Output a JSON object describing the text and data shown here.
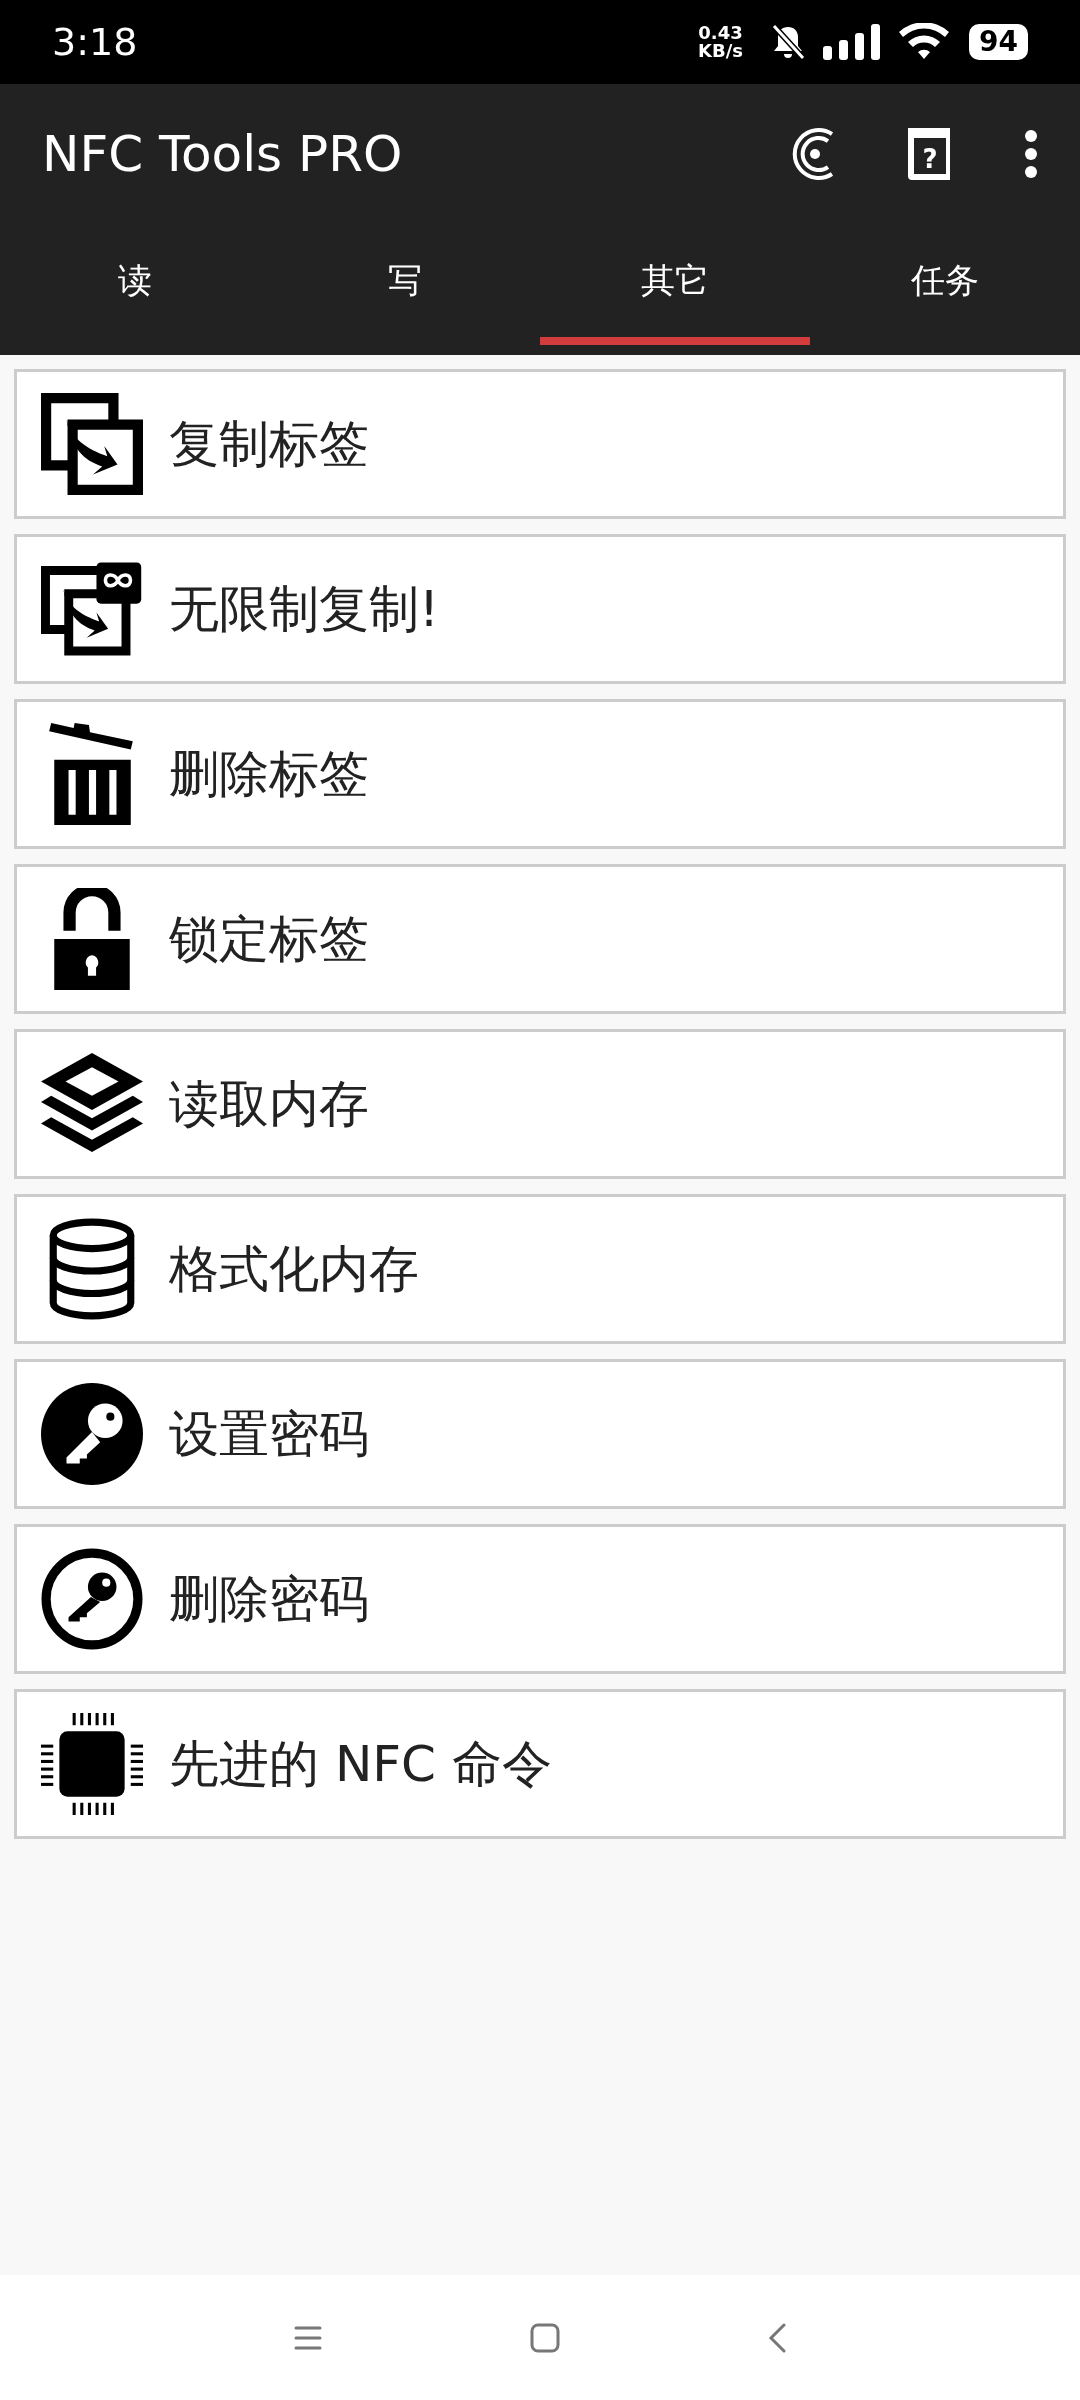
{
  "status_bar": {
    "time": "3:18",
    "net_speed": "0.43",
    "net_unit": "KB/s",
    "battery": "94"
  },
  "app_bar": {
    "title": "NFC Tools PRO",
    "help_glyph": "?"
  },
  "tabs": [
    {
      "label": "读",
      "selected": false
    },
    {
      "label": "写",
      "selected": false
    },
    {
      "label": "其它",
      "selected": true
    },
    {
      "label": "任务",
      "selected": false
    }
  ],
  "items": [
    {
      "kind": "copy",
      "label": "复制标签"
    },
    {
      "kind": "copy-unlimited",
      "label": "无限制复制!"
    },
    {
      "kind": "trash",
      "label": "删除标签"
    },
    {
      "kind": "lock",
      "label": "锁定标签"
    },
    {
      "kind": "layers",
      "label": "读取内存"
    },
    {
      "kind": "database",
      "label": "格式化内存"
    },
    {
      "kind": "key-filled",
      "label": "设置密码"
    },
    {
      "kind": "key-outline",
      "label": "删除密码"
    },
    {
      "kind": "chip",
      "label": "先进的 NFC 命令"
    }
  ]
}
